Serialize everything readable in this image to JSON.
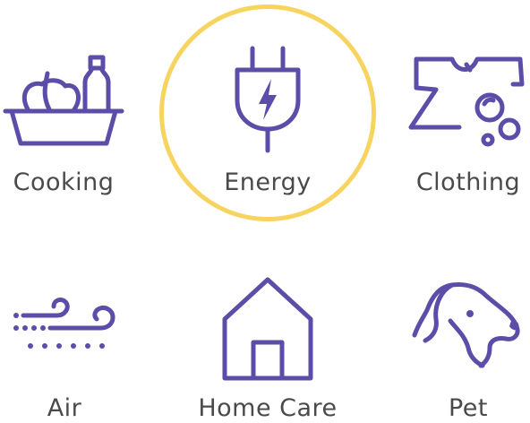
{
  "selected": "Energy",
  "accent_color": "#5b4da8",
  "highlight_color": "#f7d460",
  "categories": [
    {
      "label": "Cooking",
      "icon": "cooking-basket-icon"
    },
    {
      "label": "Energy",
      "icon": "plug-icon"
    },
    {
      "label": "Clothing",
      "icon": "shirt-icon"
    },
    {
      "label": "Air",
      "icon": "wind-icon"
    },
    {
      "label": "Home Care",
      "icon": "house-icon"
    },
    {
      "label": "Pet",
      "icon": "dog-icon"
    }
  ]
}
